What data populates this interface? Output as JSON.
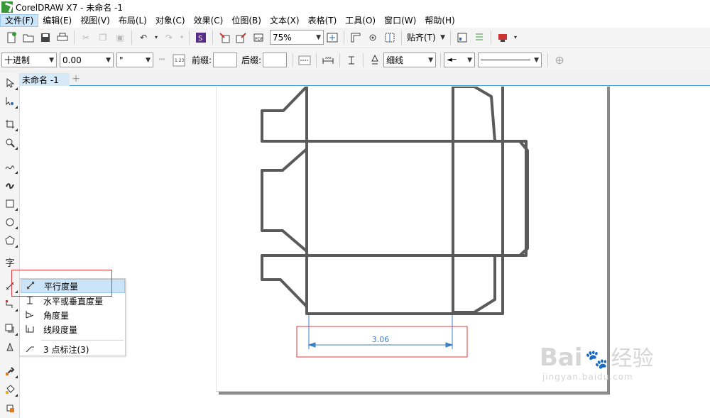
{
  "window": {
    "title": "CorelDRAW X7 - 未命名 -1"
  },
  "menubar": {
    "items": [
      "文件(F)",
      "编辑(E)",
      "视图(V)",
      "布局(L)",
      "对象(C)",
      "效果(C)",
      "位图(B)",
      "文本(X)",
      "表格(T)",
      "工具(O)",
      "窗口(W)",
      "帮助(H)"
    ]
  },
  "toolbar": {
    "zoom": "75%",
    "snap": "贴齐(T)"
  },
  "propertybar": {
    "style": "十进制",
    "precision": "0.00",
    "units": "\"",
    "prefix_label": "前缀:",
    "suffix_label": "后缀:",
    "outline": "细线"
  },
  "doc": {
    "tab": "未命名 -1"
  },
  "flyout": {
    "items": [
      "平行度量",
      "水平或垂直度量",
      "角度量",
      "线段度量",
      "3 点标注(3)"
    ]
  },
  "dimension": {
    "value": "3.06"
  },
  "watermark": {
    "brand": "Bai",
    "brand2": "经验",
    "url": "jingyan.baidu.com"
  },
  "colors": {
    "accent": "#4aa3df",
    "highlight": "#e0393e",
    "dim": "#3c7fc3"
  }
}
